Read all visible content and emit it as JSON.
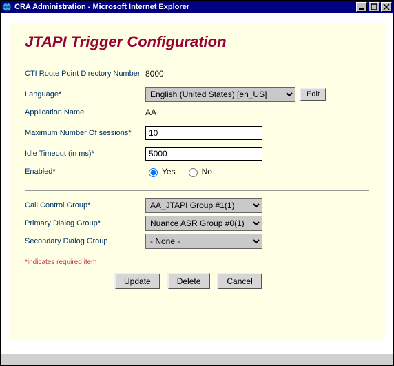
{
  "window": {
    "title": "CRA Administration - Microsoft Internet Explorer"
  },
  "page": {
    "heading": "JTAPI Trigger Configuration",
    "required_note": "*indicates required item"
  },
  "form": {
    "cti_label": "CTI Route Point Directory Number",
    "cti_value": "8000",
    "language_label": "Language*",
    "language_value": "English (United States) [en_US]",
    "edit_label": "Edit",
    "app_name_label": "Application Name",
    "app_name_value": "AA",
    "max_sessions_label": "Maximum Number Of sessions*",
    "max_sessions_value": "10",
    "idle_timeout_label": "Idle Timeout (in ms)*",
    "idle_timeout_value": "5000",
    "enabled_label": "Enabled*",
    "enabled_yes": "Yes",
    "enabled_no": "No",
    "call_control_label": "Call Control Group*",
    "call_control_value": "AA_JTAPI Group #1(1)",
    "primary_dialog_label": "Primary Dialog Group*",
    "primary_dialog_value": "Nuance ASR Group #0(1)",
    "secondary_dialog_label": "Secondary Dialog Group",
    "secondary_dialog_value": "- None -"
  },
  "actions": {
    "update": "Update",
    "delete": "Delete",
    "cancel": "Cancel"
  }
}
